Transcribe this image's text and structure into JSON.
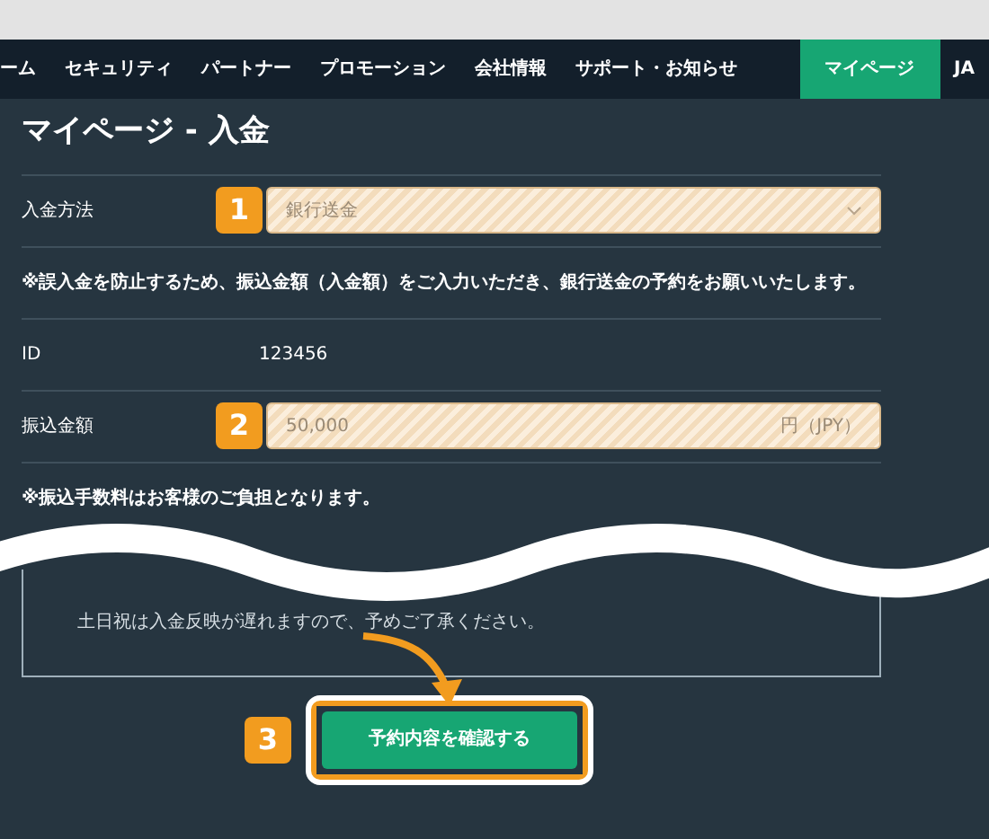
{
  "nav": {
    "items": [
      {
        "label": "ーム",
        "selected": false
      },
      {
        "label": "セキュリティ",
        "selected": false
      },
      {
        "label": "パートナー",
        "selected": false
      },
      {
        "label": "プロモーション",
        "selected": false
      },
      {
        "label": "会社情報",
        "selected": false
      },
      {
        "label": "サポート・お知らせ",
        "selected": false
      },
      {
        "label": "マイページ",
        "selected": true
      },
      {
        "label": "JA",
        "selected": false
      }
    ]
  },
  "title": "マイページ - 入金",
  "form": [
    {
      "kind": "select",
      "label": "入金方法",
      "step": "1",
      "value": "銀行送金"
    },
    {
      "kind": "note",
      "text": "※誤入金を防止するため、振込金額（入金額）をご入力いただき、銀行送金の予約をお願いいたします。"
    },
    {
      "kind": "text",
      "label": "ID",
      "value": "123456"
    },
    {
      "kind": "input",
      "label": "振込金額",
      "step": "2",
      "value": "50,000",
      "unit": "円（JPY）"
    },
    {
      "kind": "note",
      "text": "※振込手数料はお客様のご負担となります。"
    }
  ],
  "notice_box": {
    "lines": [
      "土日祝は入金反映が遅れますので、予めご了承ください。"
    ]
  },
  "submit": {
    "step": "3",
    "label": "予約内容を確認する"
  }
}
